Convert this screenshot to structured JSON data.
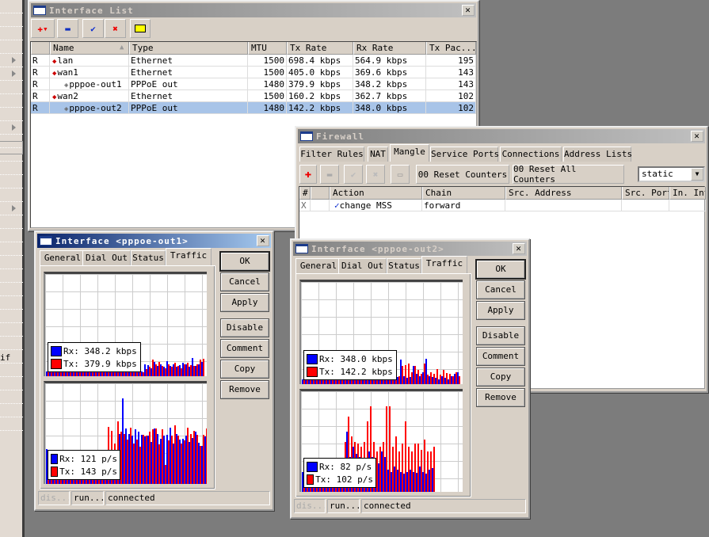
{
  "sidebar": {
    "partial_text": "if"
  },
  "interface_list": {
    "title": "Interface List",
    "toolbar": {
      "add": "✚▾",
      "remove": "▬",
      "enable": "✔",
      "disable": "✖",
      "comment": "▭"
    },
    "columns": [
      "",
      "Name",
      "Type",
      "MTU",
      "Tx Rate",
      "Rx Rate",
      "Tx Pac..."
    ],
    "rows": [
      {
        "flag": "R",
        "name": "lan",
        "type": "Ethernet",
        "mtu": "1500",
        "tx": "698.4 kbps",
        "rx": "564.9 kbps",
        "txp": "195",
        "indent": false,
        "icon": "ethernet-icon"
      },
      {
        "flag": "R",
        "name": "wan1",
        "type": "Ethernet",
        "mtu": "1500",
        "tx": "405.0 kbps",
        "rx": "369.6 kbps",
        "txp": "143",
        "indent": false,
        "icon": "ethernet-icon"
      },
      {
        "flag": "R",
        "name": "pppoe-out1",
        "type": "PPPoE out",
        "mtu": "1480",
        "tx": "379.9 kbps",
        "rx": "348.2 kbps",
        "txp": "143",
        "indent": true,
        "icon": "pppoe-icon"
      },
      {
        "flag": "R",
        "name": "wan2",
        "type": "Ethernet",
        "mtu": "1500",
        "tx": "160.2 kbps",
        "rx": "362.7 kbps",
        "txp": "102",
        "indent": false,
        "icon": "ethernet-icon"
      },
      {
        "flag": "R",
        "name": "pppoe-out2",
        "type": "PPPoE out",
        "mtu": "1480",
        "tx": "142.2 kbps",
        "rx": "348.0 kbps",
        "txp": "102",
        "indent": true,
        "icon": "pppoe-icon",
        "selected": true
      }
    ]
  },
  "firewall": {
    "title": "Firewall",
    "tabs": [
      "Filter Rules",
      "NAT",
      "Mangle",
      "Service Ports",
      "Connections",
      "Address Lists"
    ],
    "active_tab": "Mangle",
    "reset_counters": "00 Reset Counters",
    "reset_all_counters": "00 Reset All Counters",
    "filter_value": "static",
    "columns": [
      "#",
      "",
      "Action",
      "Chain",
      "Src. Address",
      "Src. Port",
      "In. Int"
    ],
    "rows": [
      {
        "num": "X",
        "action": "change MSS",
        "chain": "forward",
        "src_address": "",
        "src_port": "",
        "in_int": ""
      }
    ]
  },
  "iface1": {
    "title": "Interface <pppoe-out1>",
    "tabs": [
      "General",
      "Dial Out",
      "Status",
      "Traffic"
    ],
    "active_tab": "Traffic",
    "buttons": [
      "OK",
      "Cancel",
      "Apply",
      "Disable",
      "Comment",
      "Copy",
      "Remove"
    ],
    "rate_legend": {
      "rx": "Rx: 348.2 kbps",
      "tx": "Tx: 379.9 kbps"
    },
    "pkt_legend": {
      "rx": "Rx: 121 p/s",
      "tx": "Tx: 143 p/s"
    },
    "status": [
      "dis...",
      "run...",
      "connected"
    ],
    "rate_bars_pct": {
      "rx": [
        5,
        4,
        4,
        5,
        4,
        4,
        5,
        4,
        4,
        5,
        4,
        4,
        5,
        4,
        4,
        5,
        4,
        4,
        5,
        4,
        4,
        5,
        4,
        4,
        5,
        4,
        4,
        5,
        4,
        4,
        5,
        12,
        11,
        8,
        14,
        10,
        12,
        9,
        15,
        10,
        12,
        9,
        11,
        13,
        12,
        9,
        18,
        10,
        12,
        14
      ],
      "tx": [
        4,
        4,
        5,
        4,
        4,
        5,
        4,
        4,
        5,
        4,
        4,
        5,
        4,
        4,
        5,
        4,
        4,
        5,
        4,
        4,
        5,
        4,
        4,
        5,
        4,
        4,
        5,
        4,
        4,
        5,
        4,
        7,
        9,
        16,
        12,
        14,
        10,
        8,
        12,
        9,
        13,
        10,
        8,
        12,
        13,
        11,
        10,
        12,
        16,
        17
      ]
    },
    "pkt_bars_pct": {
      "rx": [
        35,
        33,
        30,
        34,
        30,
        32,
        31,
        30,
        33,
        31,
        32,
        30,
        31,
        33,
        30,
        32,
        31,
        30,
        32,
        31,
        30,
        32,
        33,
        50,
        85,
        55,
        50,
        48,
        54,
        52,
        49,
        47,
        48,
        42,
        55,
        50,
        45,
        48,
        49,
        56,
        40,
        50,
        44,
        45,
        48,
        42,
        46,
        52,
        41,
        38,
        47
      ],
      "tx": [
        32,
        30,
        31,
        33,
        30,
        32,
        31,
        30,
        34,
        31,
        30,
        33,
        31,
        30,
        32,
        31,
        30,
        33,
        31,
        57,
        53,
        40,
        62,
        52,
        50,
        44,
        56,
        40,
        44,
        37,
        49,
        48,
        52,
        54,
        55,
        39,
        54,
        19,
        43,
        48,
        58,
        48,
        40,
        43,
        56,
        50,
        53,
        49,
        38,
        49,
        55
      ]
    },
    "colors": {
      "rx": "#0000ff",
      "tx": "#ff0000"
    }
  },
  "iface2": {
    "title": "Interface <pppoe-out2>",
    "tabs": [
      "General",
      "Dial Out",
      "Status",
      "Traffic"
    ],
    "active_tab": "Traffic",
    "buttons": [
      "OK",
      "Cancel",
      "Apply",
      "Disable",
      "Comment",
      "Copy",
      "Remove"
    ],
    "rate_legend": {
      "rx": "Rx: 348.0 kbps",
      "tx": "Tx: 142.2 kbps"
    },
    "pkt_legend": {
      "rx": "Rx: 82 p/s",
      "tx": "Tx: 102 p/s"
    },
    "status": [
      "dis...",
      "run...",
      "connected"
    ],
    "rate_bars_pct": {
      "rx": [
        5,
        4,
        4,
        5,
        4,
        4,
        5,
        4,
        4,
        5,
        4,
        4,
        5,
        4,
        4,
        5,
        4,
        4,
        5,
        4,
        4,
        5,
        4,
        4,
        5,
        4,
        4,
        8,
        10,
        8,
        7,
        24,
        8,
        6,
        7,
        18,
        10,
        8,
        12,
        25,
        8,
        7,
        6,
        5,
        8,
        6,
        5,
        8,
        10,
        12
      ],
      "tx": [
        4,
        4,
        5,
        4,
        4,
        5,
        4,
        4,
        5,
        4,
        4,
        5,
        4,
        4,
        5,
        4,
        4,
        5,
        4,
        4,
        5,
        4,
        4,
        5,
        4,
        4,
        5,
        9,
        14,
        12,
        8,
        18,
        19,
        20,
        12,
        18,
        14,
        10,
        20,
        9,
        12,
        10,
        15,
        9,
        14,
        11,
        10,
        8,
        12,
        8
      ]
    },
    "pkt_bars_pct": {
      "rx": [
        20,
        18,
        17,
        19,
        18,
        17,
        18,
        19,
        17,
        18,
        19,
        17,
        18,
        30,
        60,
        35,
        45,
        38,
        35,
        28,
        25,
        40,
        35,
        32,
        28,
        40,
        35,
        22,
        20,
        25,
        22,
        20,
        18,
        20,
        22,
        20,
        19,
        25,
        20,
        18,
        22,
        24
      ],
      "tx": [
        18,
        17,
        19,
        18,
        17,
        19,
        18,
        17,
        18,
        19,
        17,
        18,
        19,
        50,
        75,
        55,
        50,
        48,
        45,
        50,
        70,
        85,
        50,
        40,
        45,
        50,
        85,
        85,
        45,
        55,
        40,
        48,
        70,
        45,
        40,
        48,
        48,
        42,
        52,
        40,
        40,
        45
      ]
    },
    "colors": {
      "rx": "#0000ff",
      "tx": "#ff0000"
    }
  }
}
